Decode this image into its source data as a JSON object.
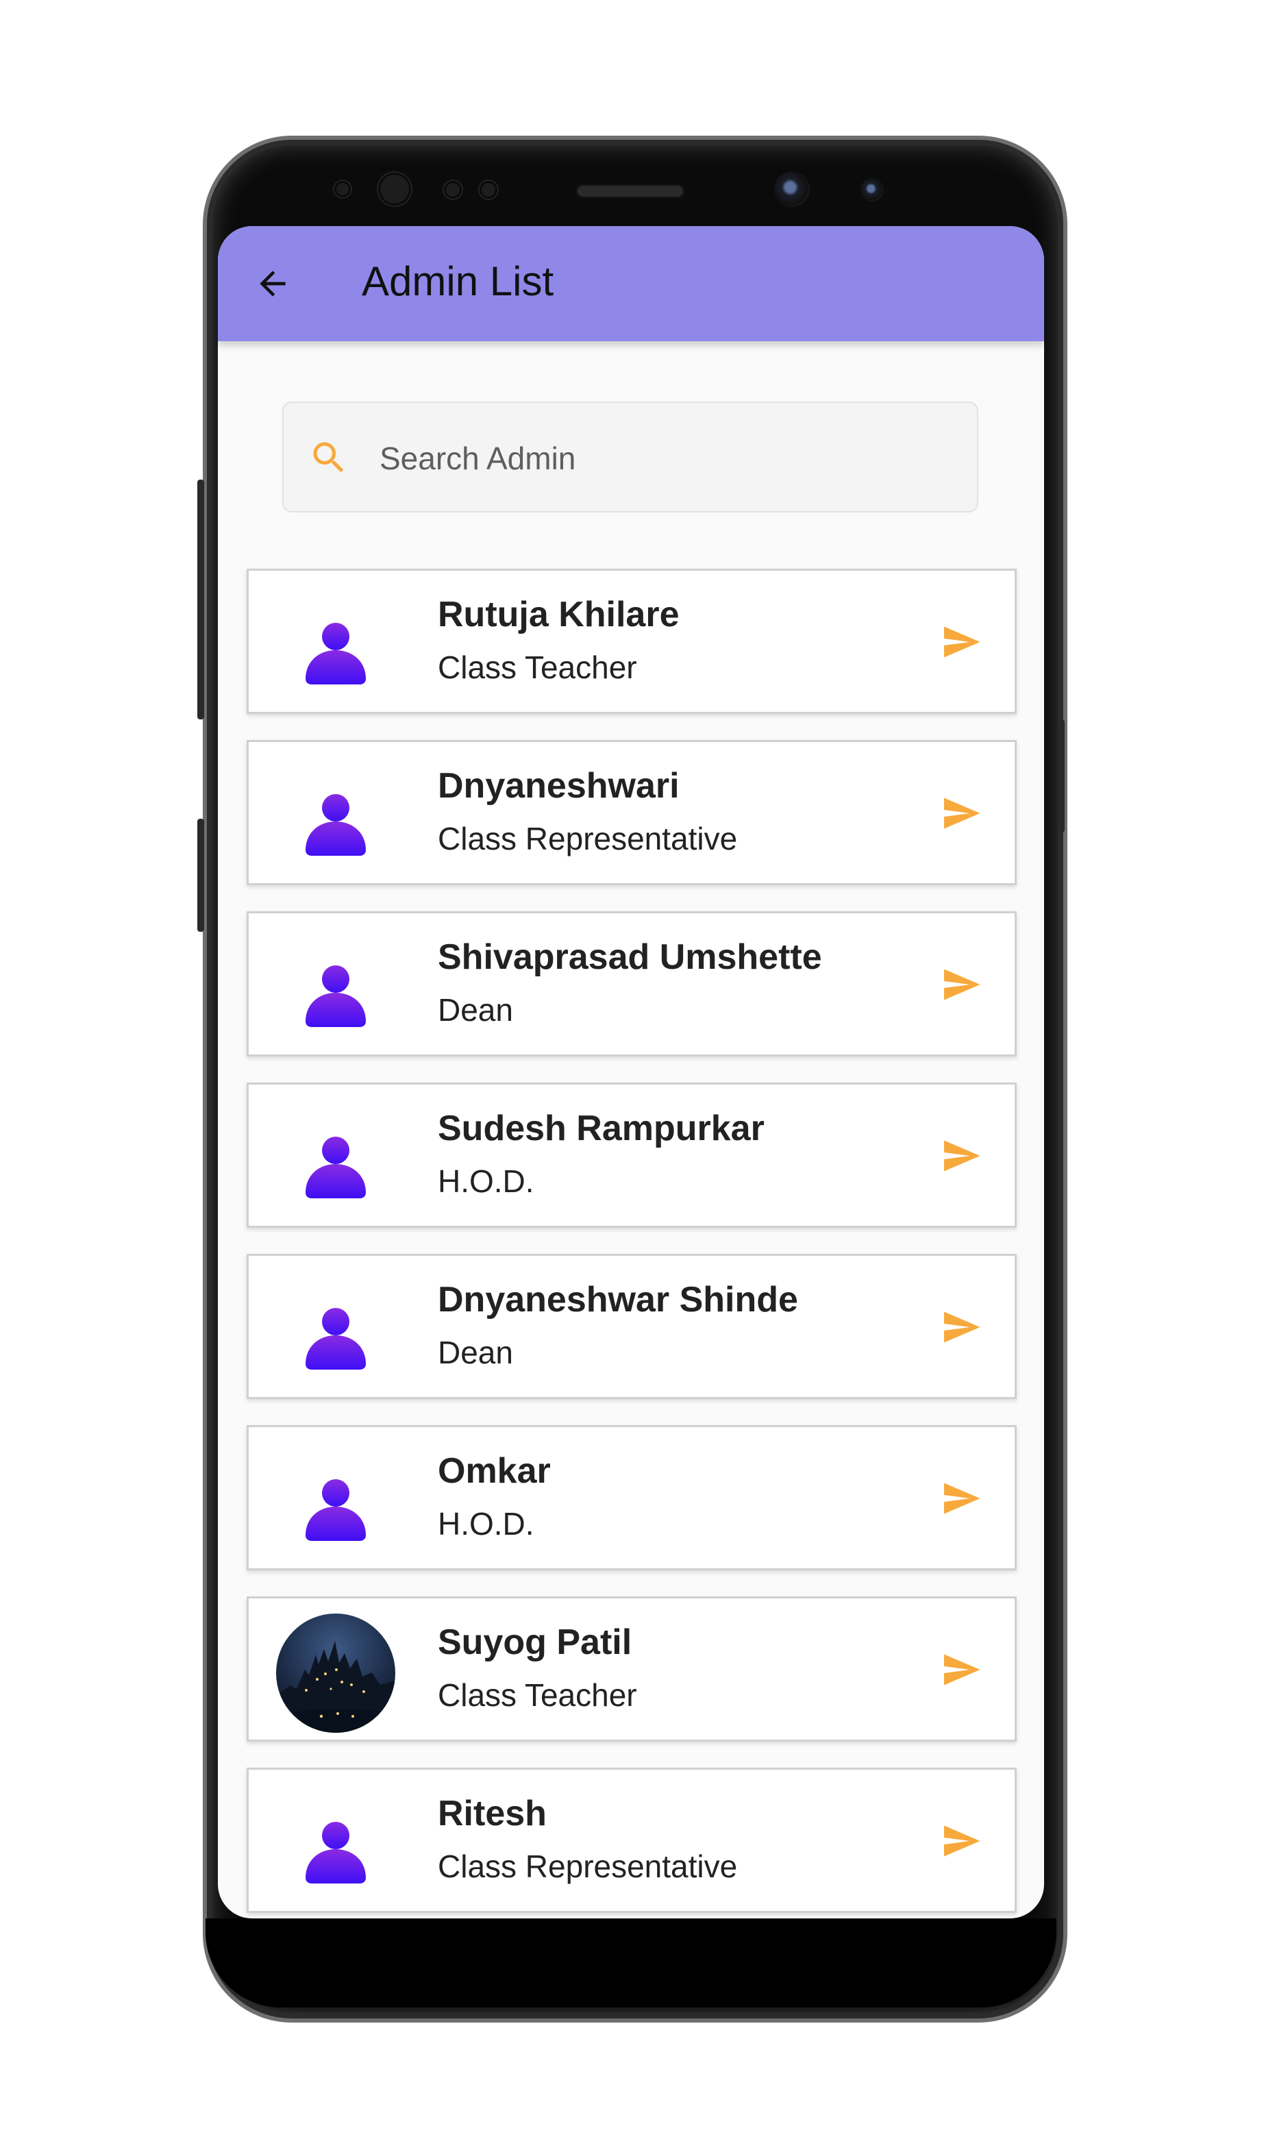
{
  "header": {
    "title": "Admin List",
    "back_icon": "arrow-left-icon"
  },
  "search": {
    "placeholder": "Search Admin",
    "value": "",
    "icon": "search-icon"
  },
  "colors": {
    "appbar": "#9088e8",
    "accent": "#f7a93b",
    "avatar": "#5b2be6"
  },
  "admins": [
    {
      "name": "Rutuja Khilare",
      "role": "Class Teacher",
      "avatar": "person-icon"
    },
    {
      "name": "Dnyaneshwari",
      "role": "Class Representative",
      "avatar": "person-icon"
    },
    {
      "name": "Shivaprasad Umshette",
      "role": "Dean",
      "avatar": "person-icon"
    },
    {
      "name": "Sudesh Rampurkar",
      "role": "H.O.D.",
      "avatar": "person-icon"
    },
    {
      "name": "Dnyaneshwar Shinde",
      "role": "Dean",
      "avatar": "person-icon"
    },
    {
      "name": "Omkar",
      "role": "H.O.D.",
      "avatar": "person-icon"
    },
    {
      "name": "Suyog Patil",
      "role": "Class Teacher",
      "avatar": "photo"
    },
    {
      "name": "Ritesh",
      "role": "Class Representative",
      "avatar": "person-icon"
    }
  ]
}
